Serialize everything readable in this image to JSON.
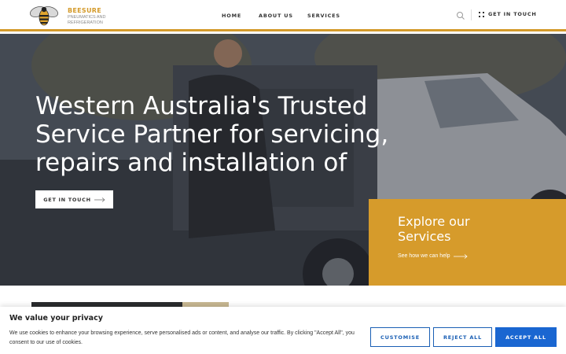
{
  "header": {
    "brand_name": "BEESURE",
    "brand_tagline": "PNEUMATICS AND REFRIGERATION",
    "nav": [
      "HOME",
      "ABOUT US",
      "SERVICES"
    ],
    "cta_label": "GET IN TOUCH",
    "icons": {
      "logo": "bee-logo",
      "search": "search-icon",
      "cta": "dots-grid-icon"
    }
  },
  "hero": {
    "title": "Western Australia's Trusted Service Partner for servicing, repairs and installation of",
    "button_label": "GET IN TOUCH",
    "explore_title": "Explore our Services",
    "explore_link": "See how we can help"
  },
  "cookie": {
    "title": "We value your privacy",
    "text": "We use cookies to enhance your browsing experience, serve personalised ads or content, and analyse our traffic. By clicking \"Accept All\", you consent to our use of cookies.",
    "buttons": [
      "CUSTOMISE",
      "REJECT ALL",
      "ACCEPT ALL"
    ]
  },
  "colors": {
    "accent": "#d69b2b",
    "primary_button": "#1a66d1"
  }
}
